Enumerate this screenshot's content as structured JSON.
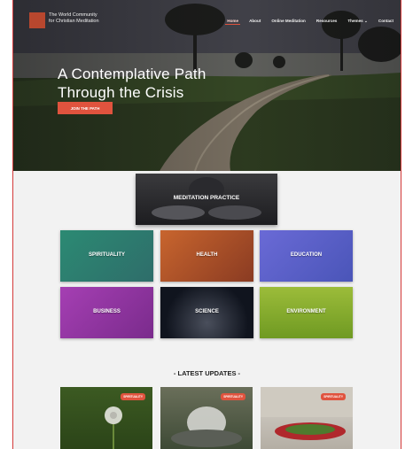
{
  "site": {
    "logo_line1": "The World Community",
    "logo_line2": "for Christian Meditation"
  },
  "nav": {
    "items": [
      "Home",
      "About",
      "Online Meditation",
      "Resources",
      "Themes",
      "Contact"
    ],
    "active_index": 0
  },
  "hero": {
    "headline_line1": "A Contemplative Path",
    "headline_line2": "Through the Crisis",
    "cta_label": "JOIN THE PATH"
  },
  "featured": {
    "label": "MEDITATION PRACTICE"
  },
  "topics": [
    {
      "label": "SPIRITUALITY",
      "color": "#2e7d6f"
    },
    {
      "label": "HEALTH",
      "color": "#b0552a"
    },
    {
      "label": "EDUCATION",
      "color": "#5b5fc7"
    },
    {
      "label": "BUSINESS",
      "color": "#9a3aa8"
    },
    {
      "label": "SCIENCE",
      "color": "#1c2436"
    },
    {
      "label": "ENVIRONMENT",
      "color": "#8fb52e"
    }
  ],
  "latest": {
    "title": "- LATEST UPDATES -",
    "badges": [
      "SPIRITUALITY",
      "SPIRITUALITY",
      "SPIRITUALITY"
    ]
  },
  "colors": {
    "accent": "#e0533e",
    "frame": "#d43a3a"
  }
}
